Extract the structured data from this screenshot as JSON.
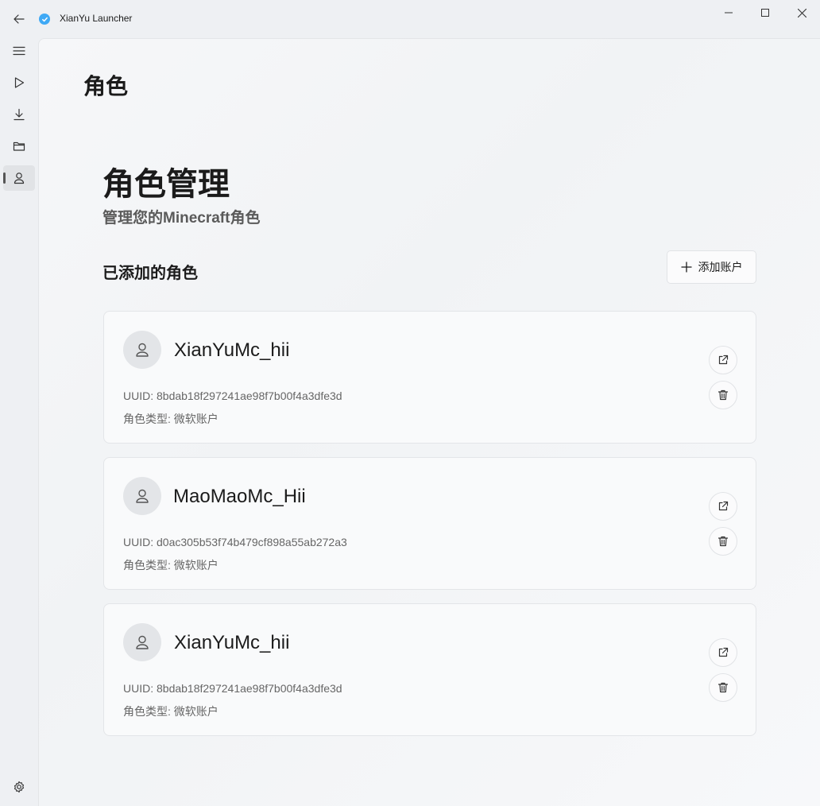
{
  "window": {
    "title": "XianYu Launcher"
  },
  "nav": {
    "items": [
      {
        "name": "menu-icon"
      },
      {
        "name": "play-icon"
      },
      {
        "name": "download-icon"
      },
      {
        "name": "folder-icon"
      },
      {
        "name": "person-icon",
        "selected": true
      }
    ],
    "settings_icon": "gear-icon"
  },
  "page": {
    "header": "角色",
    "hero_title": "角色管理",
    "hero_subtitle": "管理您的Minecraft角色",
    "section_title": "已添加的角色",
    "add_button_label": "添加账户"
  },
  "accounts": [
    {
      "name": "XianYuMc_hii",
      "uuid_label": "UUID: ",
      "uuid": "8bdab18f297241ae98f7b00f4a3dfe3d",
      "type_label": "角色类型: ",
      "type": "微软账户"
    },
    {
      "name": "MaoMaoMc_Hii",
      "uuid_label": "UUID: ",
      "uuid": "d0ac305b53f74b479cf898a55ab272a3",
      "type_label": "角色类型: ",
      "type": "微软账户"
    },
    {
      "name": "XianYuMc_hii",
      "uuid_label": "UUID: ",
      "uuid": "8bdab18f297241ae98f7b00f4a3dfe3d",
      "type_label": "角色类型: ",
      "type": "微软账户"
    }
  ],
  "colors": {
    "accent": "#3fa9f5",
    "text": "#1b1b1b",
    "muted": "#666666"
  }
}
